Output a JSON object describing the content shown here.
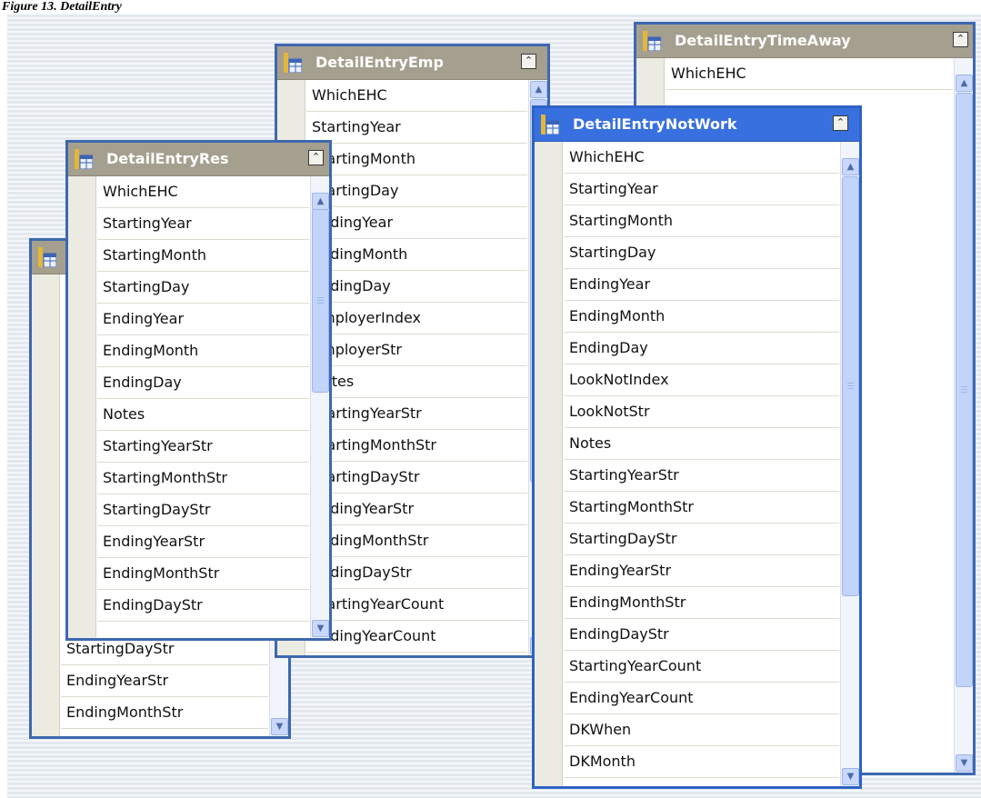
{
  "caption": "Figure 13. DetailEntry",
  "windows": {
    "back": {
      "title": "",
      "rows": [
        "StartingDayStr",
        "EndingYearStr",
        "EndingMonthStr"
      ]
    },
    "res": {
      "title": "DetailEntryRes",
      "rows": [
        "WhichEHC",
        "StartingYear",
        "StartingMonth",
        "StartingDay",
        "EndingYear",
        "EndingMonth",
        "EndingDay",
        "Notes",
        "StartingYearStr",
        "StartingMonthStr",
        "StartingDayStr",
        "EndingYearStr",
        "EndingMonthStr",
        "EndingDayStr"
      ]
    },
    "emp": {
      "title": "DetailEntryEmp",
      "rows": [
        "WhichEHC",
        "StartingYear",
        "StartingMonth",
        "StartingDay",
        "EndingYear",
        "EndingMonth",
        "EndingDay",
        "EmployerIndex",
        "EmployerStr",
        "Notes",
        "StartingYearStr",
        "StartingMonthStr",
        "StartingDayStr",
        "EndingYearStr",
        "EndingMonthStr",
        "EndingDayStr",
        "StartingYearCount",
        "EndingYearCount"
      ]
    },
    "timeaway": {
      "title": "DetailEntryTimeAway",
      "rows": [
        "WhichEHC"
      ]
    },
    "notwork": {
      "title": "DetailEntryNotWork",
      "rows": [
        "WhichEHC",
        "StartingYear",
        "StartingMonth",
        "StartingDay",
        "EndingYear",
        "EndingMonth",
        "EndingDay",
        "LookNotIndex",
        "LookNotStr",
        "Notes",
        "StartingYearStr",
        "StartingMonthStr",
        "StartingDayStr",
        "EndingYearStr",
        "EndingMonthStr",
        "EndingDayStr",
        "StartingYearCount",
        "EndingYearCount",
        "DKWhen",
        "DKMonth"
      ]
    }
  },
  "icons": {
    "table": "table-icon",
    "collapse": "double-chevron-up-icon",
    "scroll_up": "arrow-up-icon",
    "scroll_down": "arrow-down-icon"
  },
  "glyphs": {
    "collapse": "⌃",
    "up": "▲",
    "down": "▼"
  },
  "colors": {
    "window_border": "#3d68b0",
    "inactive_title": "#a59f8f",
    "active_title": "#3870df",
    "scroll_thumb": "#c3d4fa"
  }
}
